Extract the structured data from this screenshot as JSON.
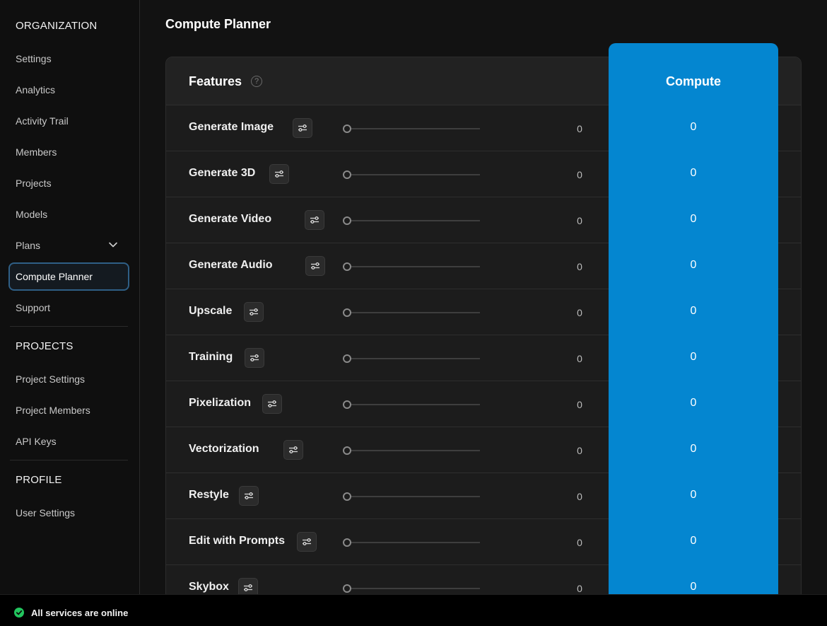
{
  "sidebar": {
    "organization_heading": "ORGANIZATION",
    "organization_items": [
      {
        "label": "Settings"
      },
      {
        "label": "Analytics"
      },
      {
        "label": "Activity Trail"
      },
      {
        "label": "Members"
      },
      {
        "label": "Projects"
      },
      {
        "label": "Models"
      },
      {
        "label": "Plans"
      },
      {
        "label": "Compute Planner"
      },
      {
        "label": "Support"
      }
    ],
    "active_item": "Compute Planner",
    "projects_heading": "PROJECTS",
    "projects_items": [
      {
        "label": "Project Settings"
      },
      {
        "label": "Project Members"
      },
      {
        "label": "API Keys"
      }
    ],
    "profile_heading": "PROFILE",
    "profile_items": [
      {
        "label": "User Settings"
      }
    ]
  },
  "main": {
    "page_title": "Compute Planner",
    "features_heading": "Features",
    "help_icon": "question-circle-icon",
    "compute_heading": "Compute",
    "accent_color": "#0486d0",
    "rows": [
      {
        "label": "Generate Image",
        "value": "0",
        "compute": "0",
        "slider_fraction": 0
      },
      {
        "label": "Generate 3D",
        "value": "0",
        "compute": "0",
        "slider_fraction": 0
      },
      {
        "label": "Generate Video",
        "value": "0",
        "compute": "0",
        "slider_fraction": 0
      },
      {
        "label": "Generate Audio",
        "value": "0",
        "compute": "0",
        "slider_fraction": 0
      },
      {
        "label": "Upscale",
        "value": "0",
        "compute": "0",
        "slider_fraction": 0
      },
      {
        "label": "Training",
        "value": "0",
        "compute": "0",
        "slider_fraction": 0
      },
      {
        "label": "Pixelization",
        "value": "0",
        "compute": "0",
        "slider_fraction": 0
      },
      {
        "label": "Vectorization",
        "value": "0",
        "compute": "0",
        "slider_fraction": 0
      },
      {
        "label": "Restyle",
        "value": "0",
        "compute": "0",
        "slider_fraction": 0
      },
      {
        "label": "Edit with Prompts",
        "value": "0",
        "compute": "0",
        "slider_fraction": 0
      },
      {
        "label": "Skybox",
        "value": "0",
        "compute": "0",
        "slider_fraction": 0
      }
    ]
  },
  "status": {
    "text": "All services are online",
    "icon": "check-circle-icon",
    "color": "#22c55e"
  }
}
